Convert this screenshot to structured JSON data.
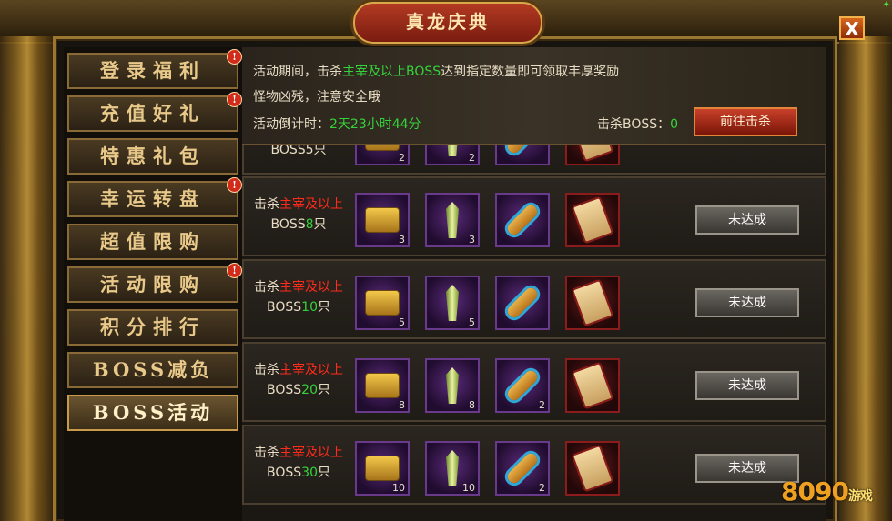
{
  "window": {
    "title": "真龙庆典",
    "close_glyph": "X"
  },
  "sidebar": {
    "items": [
      {
        "label": "登录福利",
        "badge": "!"
      },
      {
        "label": "充值好礼",
        "badge": "!"
      },
      {
        "label": "特惠礼包",
        "badge": ""
      },
      {
        "label": "幸运转盘",
        "badge": "!"
      },
      {
        "label": "超值限购",
        "badge": ""
      },
      {
        "label": "活动限购",
        "badge": "!"
      },
      {
        "label": "积分排行",
        "badge": ""
      },
      {
        "label": "BOSS减负",
        "badge": ""
      },
      {
        "label": "BOSS活动",
        "badge": "",
        "active": true
      }
    ]
  },
  "header": {
    "line1_prefix": "活动期间，击杀",
    "line1_highlight": "主宰及以上BOSS",
    "line1_suffix": "达到指定数量即可领取丰厚奖励",
    "line2": "怪物凶残，注意安全哦",
    "countdown_label": "活动倒计时：",
    "countdown_value": "2天23小时44分",
    "kill_label": "击杀BOSS：",
    "kill_value": "0",
    "go_kill_button": "前往击杀"
  },
  "rewards": [
    {
      "prefix": "击杀",
      "highlight": "主宰及以上",
      "boss": "BOSS",
      "count": "8",
      "unit": "只",
      "items": [
        {
          "name": "gold-chest-icon",
          "qty": "3"
        },
        {
          "name": "green-crystal-icon",
          "qty": "3"
        },
        {
          "name": "scroll-icon",
          "qty": ""
        },
        {
          "name": "seal-token-icon",
          "qty": ""
        }
      ],
      "status": "未达成"
    },
    {
      "prefix": "击杀",
      "highlight": "主宰及以上",
      "boss": "BOSS",
      "count": "10",
      "unit": "只",
      "items": [
        {
          "name": "gold-chest-icon",
          "qty": "5"
        },
        {
          "name": "green-crystal-icon",
          "qty": "5"
        },
        {
          "name": "scroll-icon",
          "qty": ""
        },
        {
          "name": "seal-token-icon",
          "qty": ""
        }
      ],
      "status": "未达成"
    },
    {
      "prefix": "击杀",
      "highlight": "主宰及以上",
      "boss": "BOSS",
      "count": "20",
      "unit": "只",
      "items": [
        {
          "name": "gold-chest-icon",
          "qty": "8"
        },
        {
          "name": "green-crystal-icon",
          "qty": "8"
        },
        {
          "name": "scroll-icon",
          "qty": "2"
        },
        {
          "name": "seal-token-icon",
          "qty": ""
        }
      ],
      "status": "未达成"
    },
    {
      "prefix": "击杀",
      "highlight": "主宰及以上",
      "boss": "BOSS",
      "count": "30",
      "unit": "只",
      "items": [
        {
          "name": "gold-chest-icon",
          "qty": "10"
        },
        {
          "name": "green-crystal-icon",
          "qty": "10"
        },
        {
          "name": "scroll-icon",
          "qty": "2"
        },
        {
          "name": "seal-token-icon",
          "qty": ""
        }
      ],
      "status": "未达成"
    }
  ],
  "partial_row": {
    "text": "BOSS5只",
    "items": [
      {
        "name": "gold-chest-icon",
        "qty": "2"
      },
      {
        "name": "green-crystal-icon",
        "qty": "2"
      },
      {
        "name": "scroll-icon",
        "qty": ""
      },
      {
        "name": "seal-token-icon",
        "qty": ""
      }
    ]
  },
  "watermark": {
    "brand_number": "8090",
    "brand_text": "游戏"
  },
  "colors": {
    "highlight_red": "#ff2b1b",
    "value_green": "#35d33a",
    "gold": "#d8a84a"
  }
}
